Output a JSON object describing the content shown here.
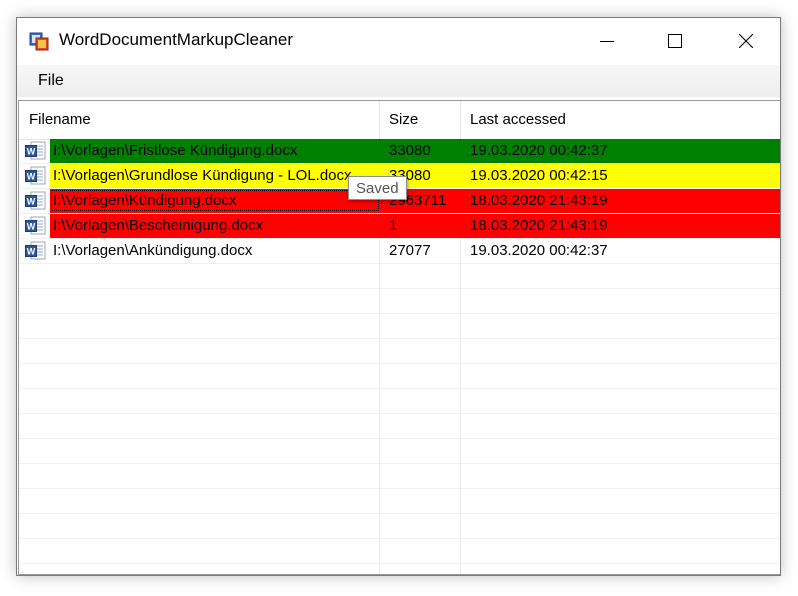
{
  "window": {
    "title": "WordDocumentMarkupCleaner"
  },
  "menu": {
    "file_label": "File"
  },
  "listview": {
    "columns": [
      "Filename",
      "Size",
      "Last accessed"
    ],
    "rows": [
      {
        "filename": "I:\\Vorlagen\\Fristlose Kündigung.docx",
        "size": "33080",
        "last_accessed": "19.03.2020 00:42:37",
        "color": "#008000",
        "icon": "word-document-icon"
      },
      {
        "filename": "I:\\Vorlagen\\Grundlose Kündigung - LOL.docx",
        "size": "33080",
        "last_accessed": "19.03.2020 00:42:15",
        "color": "#ffff00",
        "icon": "word-document-icon"
      },
      {
        "filename": "I:\\Vorlagen\\Kündigung.docx",
        "size": "2963711",
        "last_accessed": "18.03.2020 21:43:19",
        "color": "#ff0000",
        "icon": "word-document-icon"
      },
      {
        "filename": "I:\\Vorlagen\\Bescheinigung.docx",
        "size": "1",
        "last_accessed": "18.03.2020 21:43:19",
        "color": "#ff0000",
        "icon": "word-document-icon"
      },
      {
        "filename": "I:\\Vorlagen\\Ankündigung.docx",
        "size": "27077",
        "last_accessed": "19.03.2020 00:42:37",
        "color": "",
        "icon": "word-document-icon"
      }
    ]
  },
  "tooltip": {
    "text": "Saved"
  },
  "icons": {
    "app": "app-icon",
    "minimize": "minimize-icon",
    "maximize": "maximize-icon",
    "close": "close-icon"
  }
}
